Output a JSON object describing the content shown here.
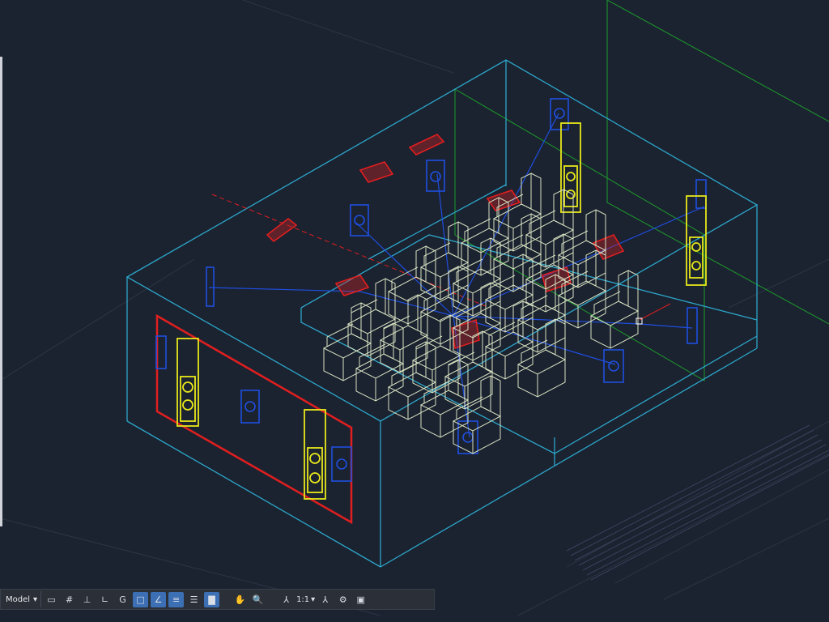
{
  "statusbar": {
    "model_label": "Model",
    "annotation_scale": "1:1",
    "buttons": [
      {
        "name": "model-space-icon",
        "glyph": "▭"
      },
      {
        "name": "grid-icon",
        "glyph": "#"
      },
      {
        "name": "snap-icon",
        "glyph": "⊥"
      },
      {
        "name": "ortho-icon",
        "glyph": "∟"
      },
      {
        "name": "polar-tracking-icon",
        "glyph": "G"
      },
      {
        "name": "object-snap-icon",
        "glyph": "□"
      },
      {
        "name": "object-snap-tracking-icon",
        "glyph": "∠"
      },
      {
        "name": "lineweight-icon",
        "glyph": "≡"
      },
      {
        "name": "transparency-icon",
        "glyph": "☰"
      },
      {
        "name": "selection-cycling-icon",
        "glyph": "▇"
      }
    ]
  },
  "colors": {
    "background": "#1b2230",
    "room_outline": "#2ca6c9",
    "seating": "#d9e3c2",
    "speaker_blue": "#1f4fe0",
    "speaker_yellow": "#e8e81a",
    "fixture_red": "#e01f1f",
    "grid_green": "#1c8a2c"
  }
}
